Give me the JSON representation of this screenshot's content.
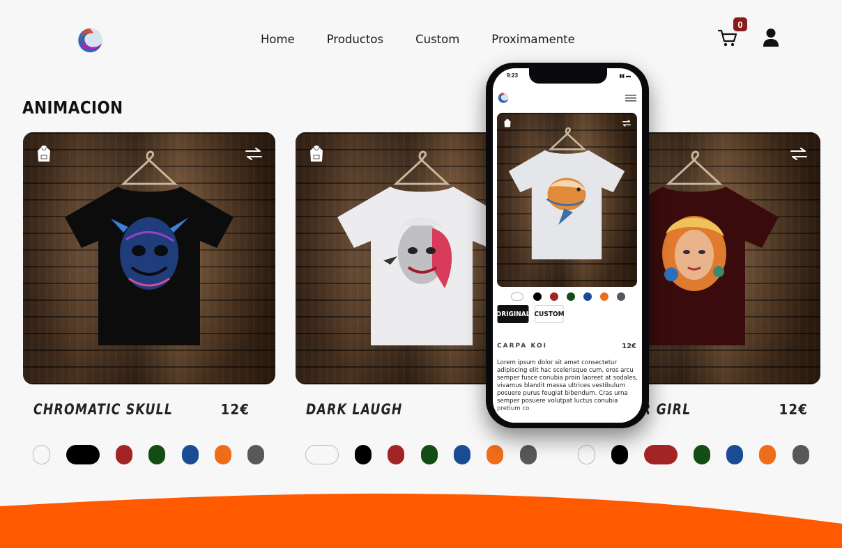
{
  "header": {
    "nav": [
      "Home",
      "Productos",
      "Custom",
      "Proximamente"
    ],
    "cart_count": "0"
  },
  "section": {
    "title": "ANIMACION"
  },
  "products": [
    {
      "name": "CHROMATIC SKULL",
      "price": "12€"
    },
    {
      "name": "DARK LAUGH",
      "price": ""
    },
    {
      "name": "R GIRL",
      "price": "12€"
    }
  ],
  "colors": {
    "white": "#ffffff",
    "black": "#000000",
    "red": "#a32424",
    "green": "#124d14",
    "blue": "#1a4c96",
    "orange": "#ef6d1a",
    "gray": "#585858",
    "accent_footer": "#ff5a00",
    "cart_badge": "#8b1a1a"
  },
  "phone": {
    "time": "9:23",
    "tab_original": "ORIGINAL",
    "tab_custom": "CUSTOM",
    "product_name": "CARPA KOI",
    "product_price": "12€",
    "description": "Lorem ipsum dolor sit amet consectetur adipiscing elit hac scelerisque cum, eros arcu semper fusce conubia proin laoreet at sodales, vivamus blandit massa ultrices vestibulum posuere purus feugiat bibendum. Cras urna semper posuere volutpat luctus conubia pretium co"
  }
}
